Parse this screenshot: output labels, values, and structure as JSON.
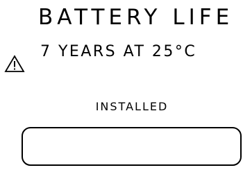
{
  "label": {
    "title": "BATTERY LIFE",
    "battery_life": "7 YEARS AT 25°C",
    "installed_label": "INSTALLED",
    "installed_value": ""
  },
  "icons": {
    "warning": "warning-triangle-icon"
  },
  "colors": {
    "ink": "#000000",
    "background": "#ffffff"
  }
}
